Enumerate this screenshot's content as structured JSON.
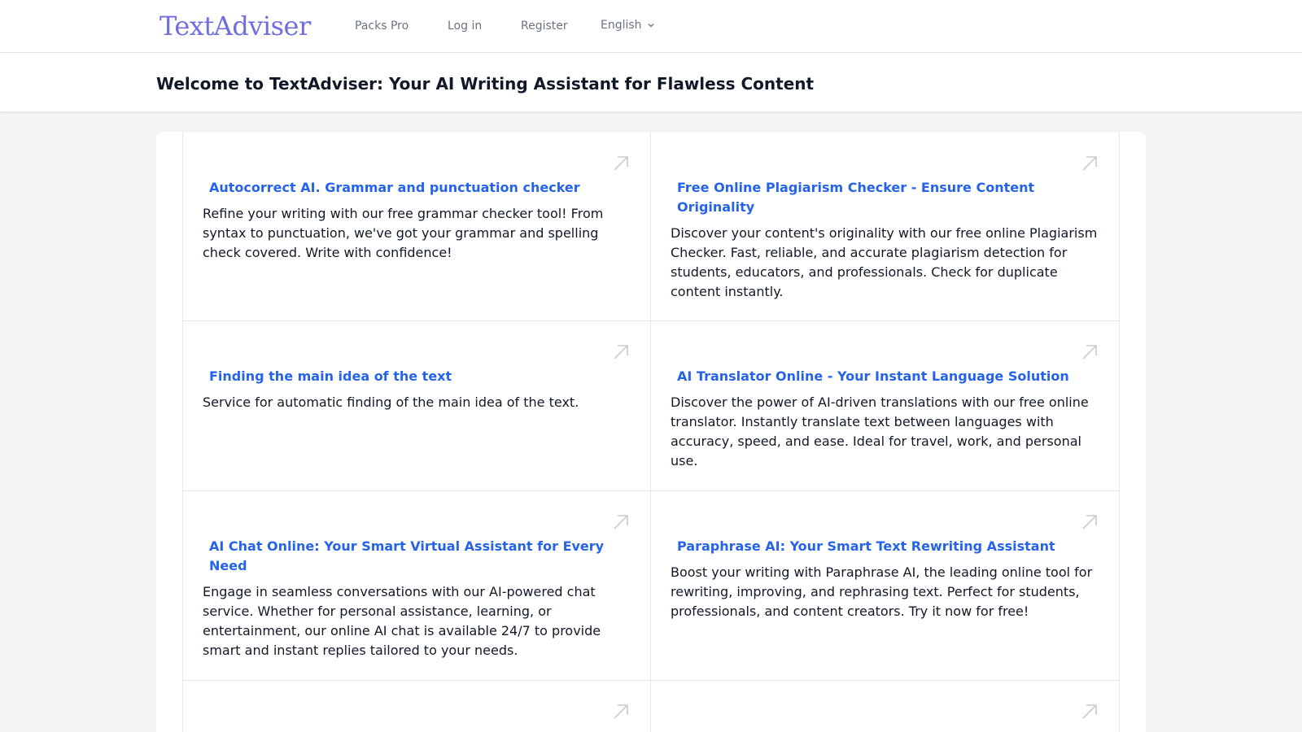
{
  "nav": {
    "logo": "TextAdviser",
    "links": [
      "Packs Pro",
      "Log in",
      "Register"
    ],
    "language": "English"
  },
  "header": {
    "title": "Welcome to TextAdviser: Your AI Writing Assistant for Flawless Content"
  },
  "services": [
    {
      "title": "Autocorrect AI. Grammar and punctuation checker",
      "description": "Refine your writing with our free grammar checker tool! From syntax to punctuation, we've got your grammar and spelling check covered. Write with confidence!"
    },
    {
      "title": "Free Online Plagiarism Checker - Ensure Content Originality",
      "description": "Discover your content's originality with our free online Plagiarism Checker. Fast, reliable, and accurate plagiarism detection for students, educators, and professionals. Check for duplicate content instantly."
    },
    {
      "title": "Finding the main idea of the text",
      "description": "Service for automatic finding of the main idea of the text."
    },
    {
      "title": "AI Translator Online - Your Instant Language Solution",
      "description": "Discover the power of AI-driven translations with our free online translator. Instantly translate text between languages with accuracy, speed, and ease. Ideal for travel, work, and personal use."
    },
    {
      "title": "AI Chat Online: Your Smart Virtual Assistant for Every Need",
      "description": "Engage in seamless conversations with our AI-powered chat service. Whether for personal assistance, learning, or entertainment, our online AI chat is available 24/7 to provide smart and instant replies tailored to your needs."
    },
    {
      "title": "Paraphrase AI: Your Smart Text Rewriting Assistant",
      "description": "Boost your writing with Paraphrase AI, the leading online tool for rewriting, improving, and rephrasing text. Perfect for students, professionals, and content creators. Try it now for free!"
    }
  ],
  "colors": {
    "logo": "#6f6ee0",
    "link": "#2563eb",
    "background": "#f3f4f6",
    "arrow_icon": "#c9c9d1"
  },
  "icons": {
    "card_link": "arrow-up-right-icon",
    "language_dropdown": "chevron-down-icon"
  }
}
